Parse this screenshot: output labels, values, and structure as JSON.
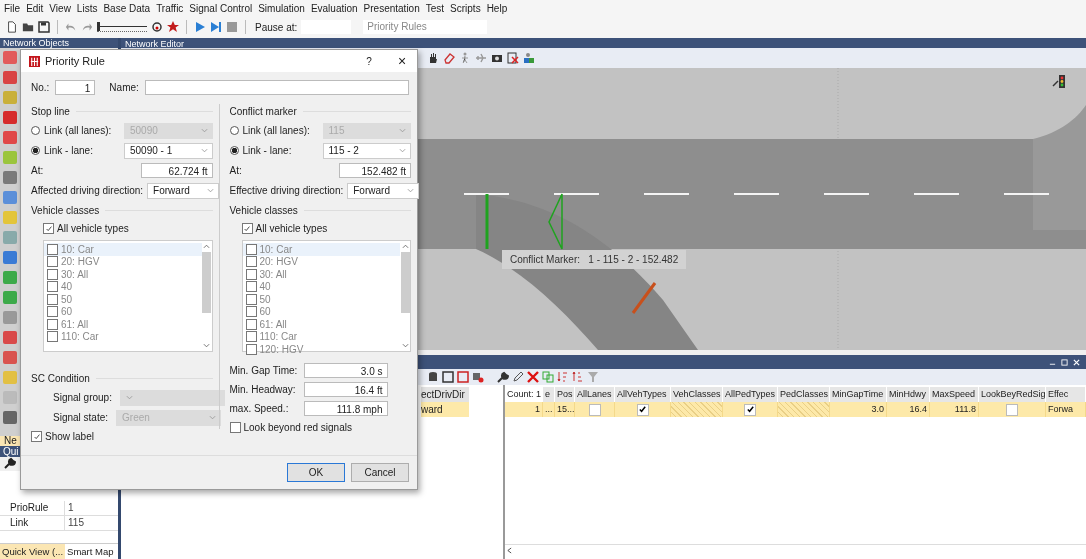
{
  "menu": [
    "File",
    "Edit",
    "View",
    "Lists",
    "Base Data",
    "Traffic",
    "Signal Control",
    "Simulation",
    "Evaluation",
    "Presentation",
    "Test",
    "Scripts",
    "Help"
  ],
  "toolbar": {
    "speed_slider": {
      "level": 0
    },
    "pause_label": "Pause at:",
    "view_select": "Priority Rules"
  },
  "left_panel": {
    "title": "Network Objects",
    "cut_item": "Ne",
    "cut_title": "Qui"
  },
  "network_editor": {
    "title": "Network Editor",
    "tooltip": "Conflict Marker:   1 - 115 - 2 - 152.482"
  },
  "dialog": {
    "title": "Priority Rule",
    "help": "?",
    "close": "×",
    "no_label": "No.:",
    "no_value": "1",
    "name_label": "Name:",
    "stop_line": {
      "title": "Stop line",
      "options": [
        {
          "label": "Link (all lanes):",
          "value": "50090",
          "selected": false
        },
        {
          "label": "Link - lane:",
          "value": "50090 - 1",
          "selected": true
        }
      ],
      "at_label": "At:",
      "at_value": "62.724 ft",
      "direction_label": "Affected driving direction:",
      "direction_value": "Forward",
      "classes_title": "Vehicle classes",
      "all_types": {
        "label": "All vehicle types",
        "checked": true
      },
      "classes": [
        {
          "label": "10: Car",
          "checked": false
        },
        {
          "label": "20: HGV",
          "checked": false
        },
        {
          "label": "30: All",
          "checked": false
        },
        {
          "label": "40",
          "checked": false
        },
        {
          "label": "50",
          "checked": false
        },
        {
          "label": "60",
          "checked": false
        },
        {
          "label": "61: All",
          "checked": false
        },
        {
          "label": "110: Car",
          "checked": false
        }
      ]
    },
    "conflict_marker": {
      "title": "Conflict marker",
      "options": [
        {
          "label": "Link (all lanes):",
          "value": "115",
          "selected": false
        },
        {
          "label": "Link - lane:",
          "value": "115 - 2",
          "selected": true
        }
      ],
      "at_label": "At:",
      "at_value": "152.482 ft",
      "direction_label": "Effective driving direction:",
      "direction_value": "Forward",
      "classes_title": "Vehicle classes",
      "all_types": {
        "label": "All vehicle types",
        "checked": true
      },
      "classes": [
        {
          "label": "10: Car",
          "checked": false
        },
        {
          "label": "20: HGV",
          "checked": false
        },
        {
          "label": "30: All",
          "checked": false
        },
        {
          "label": "40",
          "checked": false
        },
        {
          "label": "50",
          "checked": false
        },
        {
          "label": "60",
          "checked": false
        },
        {
          "label": "61: All",
          "checked": false
        },
        {
          "label": "110: Car",
          "checked": false
        },
        {
          "label": "120: HGV",
          "checked": false
        }
      ]
    },
    "sc_condition": {
      "title": "SC Condition",
      "disabled": true,
      "signal_group_label": "Signal group:",
      "signal_state_label": "Signal state:",
      "signal_state_value": "Green"
    },
    "show_label": {
      "label": "Show label",
      "checked": true
    },
    "fields": [
      {
        "label": "Min. Gap Time:",
        "value": "3.0 s"
      },
      {
        "label": "Min. Headway:",
        "value": "16.4 ft"
      },
      {
        "label": "max. Speed.:",
        "value": "111.8 mph"
      }
    ],
    "look_beyond": {
      "label": "Look beyond red signals",
      "checked": false
    },
    "buttons": [
      {
        "label": "OK",
        "default": true
      },
      {
        "label": "Cancel",
        "default": false
      }
    ]
  },
  "list_panel": {
    "side_header": "ectDrivDir",
    "side_value": "ward",
    "columns": [
      "Count: 1",
      "e",
      "Pos",
      "AllLanes",
      "AllVehTypes",
      "VehClasses",
      "AllPedTypes",
      "PedClasses",
      "MinGapTime",
      "MinHdwy",
      "MaxSpeed",
      "LookBeyRedSig",
      "Effec"
    ],
    "rows": [
      {
        "selected": true,
        "cells": [
          {
            "kind": "text",
            "text": "1"
          },
          {
            "kind": "text",
            "text": "..."
          },
          {
            "kind": "text",
            "text": "15..."
          },
          {
            "kind": "check",
            "checked": false
          },
          {
            "kind": "check",
            "checked": true
          },
          {
            "kind": "hatched"
          },
          {
            "kind": "check",
            "checked": true
          },
          {
            "kind": "hatched"
          },
          {
            "kind": "text",
            "text": "3.0"
          },
          {
            "kind": "text",
            "text": "16.4"
          },
          {
            "kind": "text",
            "text": "111.8"
          },
          {
            "kind": "check",
            "checked": false
          },
          {
            "kind": "text",
            "text": "Forwa"
          }
        ]
      }
    ]
  },
  "quick_view": {
    "rows": [
      {
        "label": "PrioRule",
        "value": "1"
      },
      {
        "label": "Link",
        "value": "115"
      }
    ],
    "tabs": [
      {
        "label": "Quick View (...",
        "selected": true
      },
      {
        "label": "Smart Map",
        "selected": false
      }
    ]
  }
}
